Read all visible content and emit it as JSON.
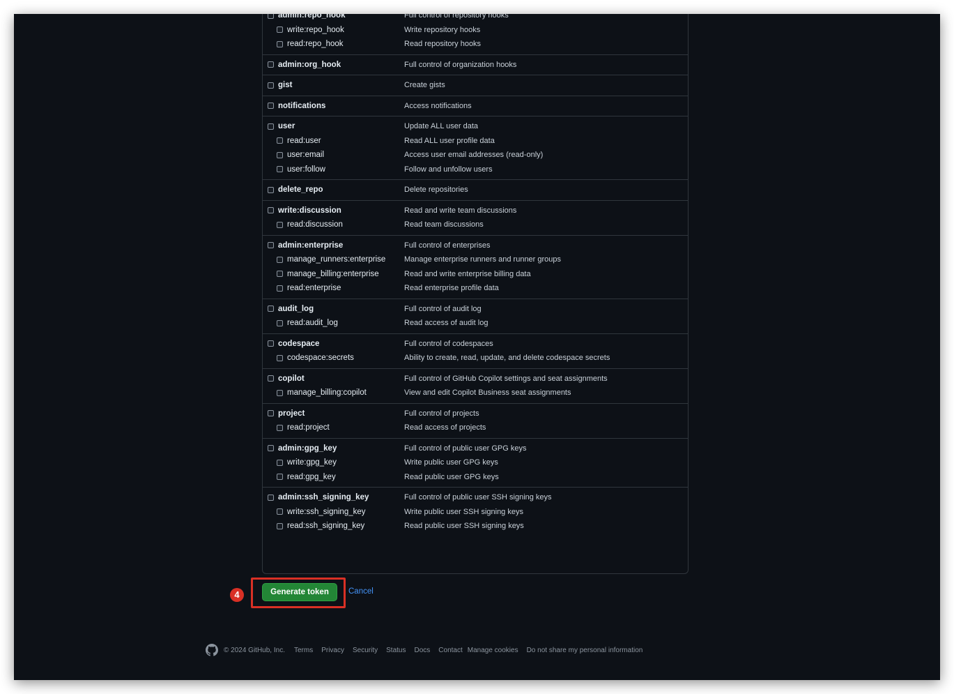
{
  "scope_groups": [
    {
      "parent": {
        "name": "admin:repo_hook",
        "description": "Full control of repository hooks"
      },
      "children": [
        {
          "name": "write:repo_hook",
          "description": "Write repository hooks"
        },
        {
          "name": "read:repo_hook",
          "description": "Read repository hooks"
        }
      ]
    },
    {
      "parent": {
        "name": "admin:org_hook",
        "description": "Full control of organization hooks"
      },
      "children": []
    },
    {
      "parent": {
        "name": "gist",
        "description": "Create gists"
      },
      "children": []
    },
    {
      "parent": {
        "name": "notifications",
        "description": "Access notifications"
      },
      "children": []
    },
    {
      "parent": {
        "name": "user",
        "description": "Update ALL user data"
      },
      "children": [
        {
          "name": "read:user",
          "description": "Read ALL user profile data"
        },
        {
          "name": "user:email",
          "description": "Access user email addresses (read-only)"
        },
        {
          "name": "user:follow",
          "description": "Follow and unfollow users"
        }
      ]
    },
    {
      "parent": {
        "name": "delete_repo",
        "description": "Delete repositories"
      },
      "children": []
    },
    {
      "parent": {
        "name": "write:discussion",
        "description": "Read and write team discussions"
      },
      "children": [
        {
          "name": "read:discussion",
          "description": "Read team discussions"
        }
      ]
    },
    {
      "parent": {
        "name": "admin:enterprise",
        "description": "Full control of enterprises"
      },
      "children": [
        {
          "name": "manage_runners:enterprise",
          "description": "Manage enterprise runners and runner groups"
        },
        {
          "name": "manage_billing:enterprise",
          "description": "Read and write enterprise billing data"
        },
        {
          "name": "read:enterprise",
          "description": "Read enterprise profile data"
        }
      ]
    },
    {
      "parent": {
        "name": "audit_log",
        "description": "Full control of audit log"
      },
      "children": [
        {
          "name": "read:audit_log",
          "description": "Read access of audit log"
        }
      ]
    },
    {
      "parent": {
        "name": "codespace",
        "description": "Full control of codespaces"
      },
      "children": [
        {
          "name": "codespace:secrets",
          "description": "Ability to create, read, update, and delete codespace secrets"
        }
      ]
    },
    {
      "parent": {
        "name": "copilot",
        "description": "Full control of GitHub Copilot settings and seat assignments"
      },
      "children": [
        {
          "name": "manage_billing:copilot",
          "description": "View and edit Copilot Business seat assignments"
        }
      ]
    },
    {
      "parent": {
        "name": "project",
        "description": "Full control of projects"
      },
      "children": [
        {
          "name": "read:project",
          "description": "Read access of projects"
        }
      ]
    },
    {
      "parent": {
        "name": "admin:gpg_key",
        "description": "Full control of public user GPG keys"
      },
      "children": [
        {
          "name": "write:gpg_key",
          "description": "Write public user GPG keys"
        },
        {
          "name": "read:gpg_key",
          "description": "Read public user GPG keys"
        }
      ]
    },
    {
      "parent": {
        "name": "admin:ssh_signing_key",
        "description": "Full control of public user SSH signing keys"
      },
      "children": [
        {
          "name": "write:ssh_signing_key",
          "description": "Write public user SSH signing keys"
        },
        {
          "name": "read:ssh_signing_key",
          "description": "Read public user SSH signing keys"
        }
      ]
    }
  ],
  "actions": {
    "step_number": "4",
    "generate_label": "Generate token",
    "cancel_label": "Cancel"
  },
  "footer": {
    "copyright": "© 2024 GitHub, Inc.",
    "links": [
      "Terms",
      "Privacy",
      "Security",
      "Status",
      "Docs",
      "Contact",
      "Manage cookies",
      "Do not share my personal information"
    ]
  },
  "colors": {
    "page_bg": "#0d1117",
    "border": "#30363d",
    "primary_button": "#238636",
    "link": "#4493f8",
    "highlight": "#d93025"
  },
  "icons": {
    "footer_logo": "github-mark-icon"
  }
}
